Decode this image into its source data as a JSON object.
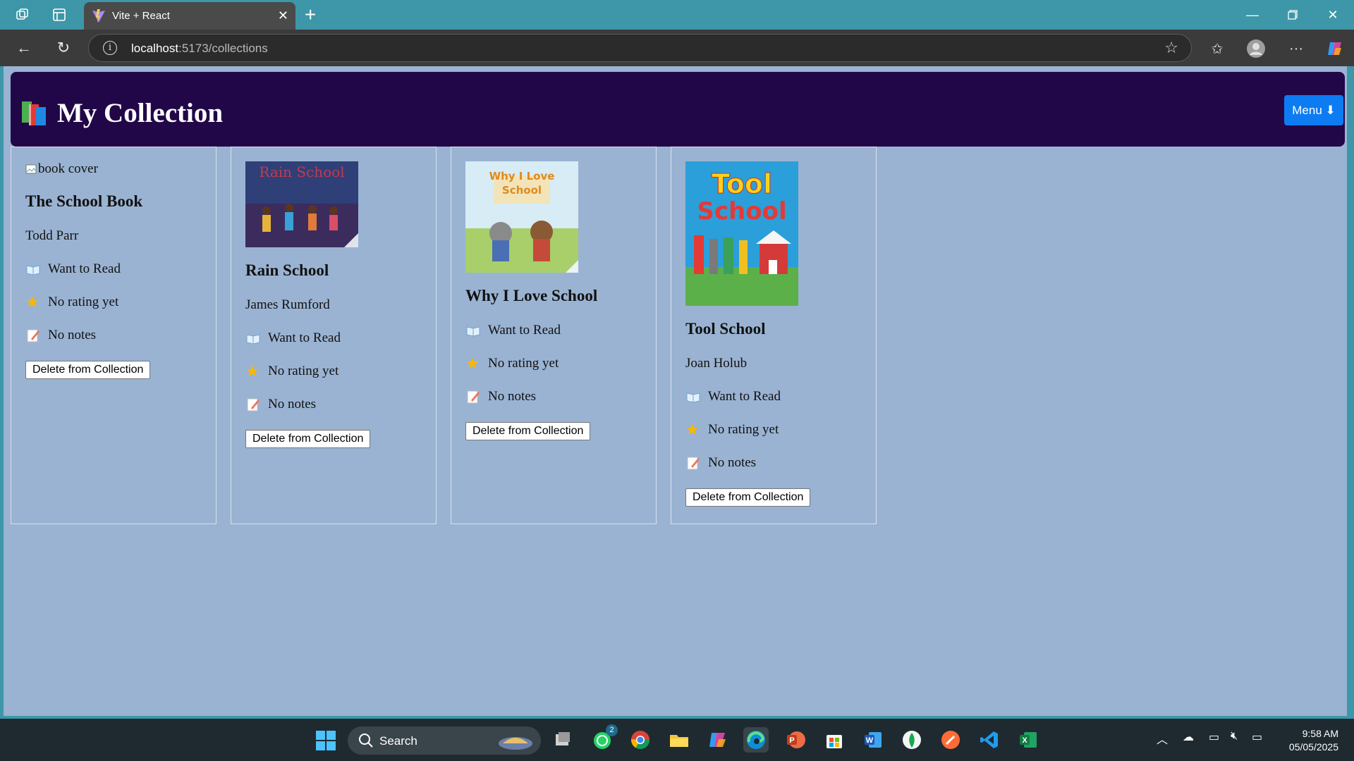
{
  "browser": {
    "tab_title": "Vite + React",
    "url_host": "localhost",
    "url_rest": ":5173/collections"
  },
  "header": {
    "title": "My Collection",
    "menu_label": "Menu ⬇"
  },
  "books": [
    {
      "title": "The School Book",
      "author": "Todd Parr",
      "cover_alt": "book cover",
      "cover_broken": true,
      "status": "Want to Read",
      "rating": "No rating yet",
      "notes": "No notes",
      "delete_label": "Delete from Collection"
    },
    {
      "title": "Rain School",
      "author": "James Rumford",
      "cover_text": "Rain School",
      "status": "Want to Read",
      "rating": "No rating yet",
      "notes": "No notes",
      "delete_label": "Delete from Collection"
    },
    {
      "title": "Why I Love School",
      "author": "",
      "cover_text": "Why I Love School",
      "status": "Want to Read",
      "rating": "No rating yet",
      "notes": "No notes",
      "delete_label": "Delete from Collection"
    },
    {
      "title": "Tool School",
      "author": "Joan Holub",
      "cover_text": "Tool School",
      "status": "Want to Read",
      "rating": "No rating yet",
      "notes": "No notes",
      "delete_label": "Delete from Collection"
    }
  ],
  "taskbar": {
    "search_label": "Search",
    "whatsapp_badge": "2",
    "time": "9:58 AM",
    "date": "05/05/2025"
  },
  "colors": {
    "header_bg": "#220748",
    "page_bg": "#9ab3d2",
    "menu_button": "#0d7cf2",
    "browser_frame": "#3d97a8"
  }
}
